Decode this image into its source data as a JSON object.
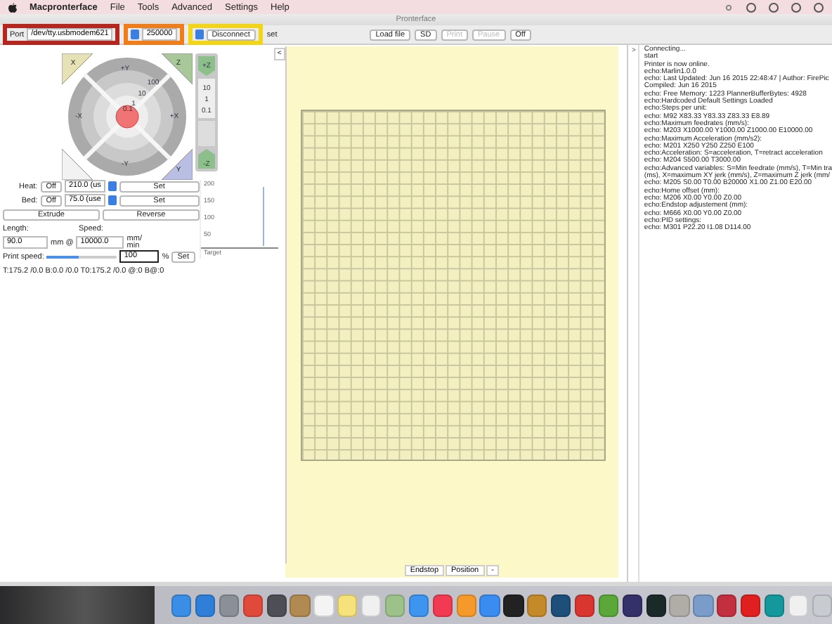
{
  "menubar": {
    "app": "Macpronterface",
    "items": [
      "File",
      "Tools",
      "Advanced",
      "Settings",
      "Help"
    ]
  },
  "window": {
    "title": "Pronterface"
  },
  "toolbar": {
    "port_label": "Port",
    "port": {
      "value": "/dev/tty.usbmodem621",
      "color": "#b5261e"
    },
    "baud": {
      "value": "250000",
      "color": "#ef7d1a"
    },
    "connect": {
      "label": "Disconnect",
      "color": "#f2d516"
    },
    "reset": "set",
    "file_buttons": [
      {
        "label": "Load file",
        "disabled": false
      },
      {
        "label": "SD",
        "disabled": false
      },
      {
        "label": "Print",
        "disabled": true
      },
      {
        "label": "Pause",
        "disabled": true
      },
      {
        "label": "Off",
        "disabled": false
      }
    ]
  },
  "jog": {
    "ring_labels": [
      "+Y",
      "-Y",
      "-X",
      "+X",
      "100",
      "10",
      "1",
      "0.1"
    ],
    "home_labels": [
      "X",
      "Z",
      "Y"
    ],
    "z_labels": [
      "+Z",
      "10",
      "1",
      "0.1",
      "-Z"
    ]
  },
  "temps": [
    {
      "label": "Heat:",
      "off": "Off",
      "value": "210.0 (us",
      "set": "Set"
    },
    {
      "label": "Bed:",
      "off": "Off",
      "value": "75.0 (use",
      "set": "Set"
    }
  ],
  "extrude": {
    "buttons": [
      "Extrude",
      "Reverse"
    ],
    "length_label": "Length:",
    "length": "90.0",
    "unit1": "mm @",
    "speed_label": "Speed:",
    "speed": "10000.0",
    "unit2": "mm/ min"
  },
  "print_speed": {
    "label": "Print speed:",
    "level": 0.45,
    "value": "100",
    "unit": "%",
    "set": "Set"
  },
  "status": "T:175.2 /0.0 B:0.0 /0.0 T0:175.2 /0.0 @:0 B@:0",
  "graph": {
    "yticks": [
      "200",
      "150",
      "100",
      "50"
    ],
    "legend": "Target"
  },
  "canvas": {
    "toggle": "<",
    "tabs": [
      "Endstop",
      "Position",
      "-"
    ]
  },
  "console": {
    "toggle": ">",
    "lines": [
      "Connecting...",
      "start",
      "Printer is now online.",
      "echo:Marlin1.0.0",
      "echo: Last Updated: Jun 16 2015 22:48:47 | Author: FirePic",
      "Compiled: Jun 16 2015",
      "echo: Free Memory: 1223  PlannerBufferBytes: 4928",
      "echo:Hardcoded Default Settings Loaded",
      "echo:Steps per unit:",
      "echo:  M92 X83.33 Y83.33 Z83.33 E8.89",
      "echo:Maximum feedrates (mm/s):",
      "echo:  M203 X1000.00 Y1000.00 Z1000.00 E10000.00",
      "echo:Maximum Acceleration (mm/s2):",
      "echo:  M201 X250 Y250 Z250 E100",
      "echo:Acceleration: S=acceleration, T=retract acceleration",
      "echo:  M204 S500.00 T3000.00",
      "echo:Advanced variables: S=Min feedrate (mm/s), T=Min tra",
      "(ms), X=maximum XY jerk (mm/s),  Z=maximum Z jerk (mm/",
      "echo:  M205 S0.00 T0.00 B20000 X1.00 Z1.00 E20.00",
      "echo:Home offset (mm):",
      "echo:  M206 X0.00 Y0.00 Z0.00",
      "echo:Endstop adjustement (mm):",
      "echo:  M666 X0.00 Y0.00 Z0.00",
      "echo:PID settings:",
      "echo:   M301 P22.20 I1.08 D114.00"
    ]
  },
  "dock": [
    {
      "color": "#3a8ee6"
    },
    {
      "color": "#2f7fd8"
    },
    {
      "color": "#8a8f98"
    },
    {
      "color": "#e04a3a"
    },
    {
      "color": "#4d4f55"
    },
    {
      "color": "#b08a50"
    },
    {
      "color": "#f4f4f4"
    },
    {
      "color": "#f5e27a"
    },
    {
      "color": "#f0f0f0"
    },
    {
      "color": "#9cc28a"
    },
    {
      "color": "#3d95f0"
    },
    {
      "color": "#f23b52"
    },
    {
      "color": "#f59a2a"
    },
    {
      "color": "#3a8cf0"
    },
    {
      "color": "#222222"
    },
    {
      "color": "#c48a2a"
    },
    {
      "color": "#1d4f7a"
    },
    {
      "color": "#d8362e"
    },
    {
      "color": "#5aa83a"
    },
    {
      "color": "#34306a"
    },
    {
      "color": "#1a2a28"
    },
    {
      "color": "#b0aca6"
    },
    {
      "color": "#7a9cc8"
    },
    {
      "color": "#c23040"
    },
    {
      "color": "#e02020"
    },
    {
      "color": "#15989c"
    },
    {
      "color": "#f0f0f0"
    },
    {
      "color": "#c8ccd0"
    }
  ]
}
